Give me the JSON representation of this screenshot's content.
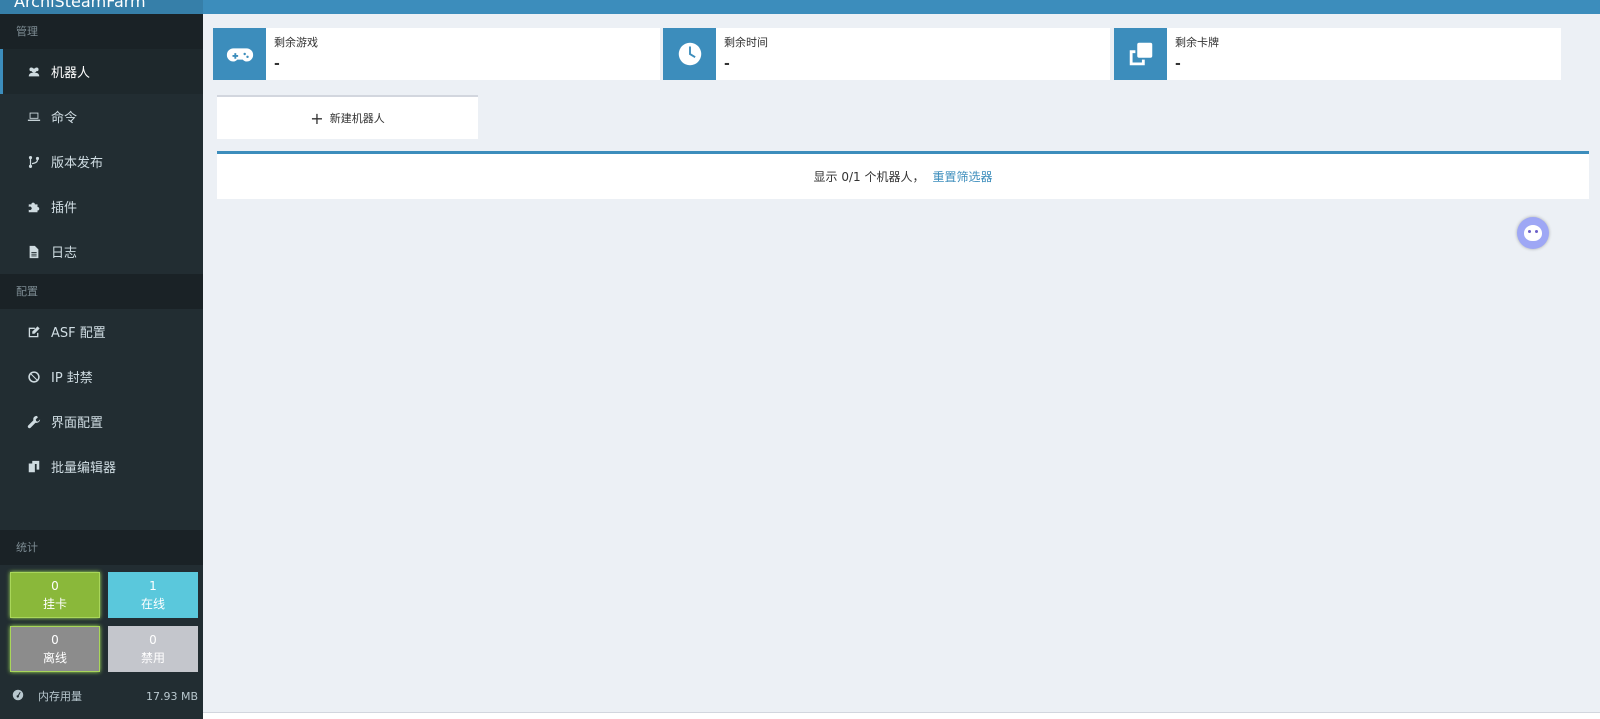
{
  "sidebar": {
    "brand": "ArchiSteamFarm",
    "sections": {
      "manage": "管理",
      "config": "配置",
      "stats": "统计"
    },
    "manage_items": [
      {
        "label": "机器人",
        "icon": "users-icon",
        "active": true
      },
      {
        "label": "命令",
        "icon": "laptop-icon",
        "active": false
      },
      {
        "label": "版本发布",
        "icon": "code-branch-icon",
        "active": false
      },
      {
        "label": "插件",
        "icon": "puzzle-icon",
        "active": false
      },
      {
        "label": "日志",
        "icon": "file-icon",
        "active": false
      }
    ],
    "config_items": [
      {
        "label": "ASF 配置",
        "icon": "edit-icon"
      },
      {
        "label": "IP 封禁",
        "icon": "ban-icon"
      },
      {
        "label": "界面配置",
        "icon": "wrench-icon"
      },
      {
        "label": "批量编辑器",
        "icon": "copy-icon"
      }
    ],
    "stats": {
      "farming": {
        "value": "0",
        "label": "挂卡",
        "color": "#8ab83a"
      },
      "online": {
        "value": "1",
        "label": "在线",
        "color": "#5ac8dc"
      },
      "offline": {
        "value": "0",
        "label": "离线",
        "color": "#8c8c8c"
      },
      "disabled": {
        "value": "0",
        "label": "禁用",
        "color": "#c4c6cc"
      }
    },
    "memory": {
      "label": "内存用量",
      "value": "17.93 MB",
      "icon": "tachometer-icon"
    }
  },
  "main": {
    "info_boxes": [
      {
        "title": "剩余游戏",
        "value": "-",
        "icon": "gamepad-icon"
      },
      {
        "title": "剩余时间",
        "value": "-",
        "icon": "clock-icon"
      },
      {
        "title": "剩余卡牌",
        "value": "-",
        "icon": "clone-icon"
      }
    ],
    "new_bot_label": "新建机器人",
    "bots_summary": "显示 0/1 个机器人，",
    "reset_filter_label": "重置筛选器"
  },
  "colors": {
    "accent": "#3c8dbc",
    "sidebar_bg": "#222d32",
    "content_bg": "#ecf0f5"
  }
}
